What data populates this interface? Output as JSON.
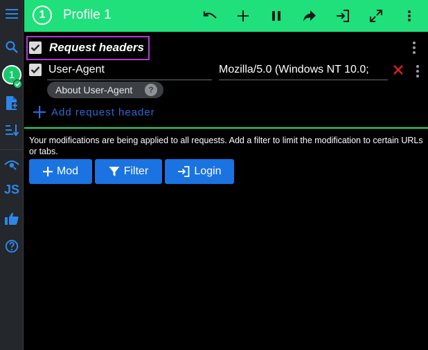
{
  "header": {
    "profile_number": "1",
    "title": "Profile 1",
    "accent_color": "#1fe07a",
    "actions": [
      "undo-icon",
      "plus-icon",
      "pause-icon",
      "share-icon",
      "login-icon",
      "expand-icon",
      "more-vert-icon"
    ]
  },
  "sidebar": {
    "items": [
      "menu-icon",
      "search-icon",
      "profile-1",
      "file-add-icon",
      "sort-icon",
      "eye-icon",
      "js-icon",
      "thumb-up-icon",
      "help-icon"
    ],
    "profile_badge": "1",
    "js_label": "JS"
  },
  "section": {
    "title": "Request headers",
    "enabled": true,
    "highlight_color": "#b43bd8"
  },
  "headers": [
    {
      "enabled": true,
      "name": "User-Agent",
      "value": "Mozilla/5.0 (Windows NT 10.0;",
      "about_label": "About User-Agent",
      "help_glyph": "?"
    }
  ],
  "add_header_label": "Add request header",
  "info_text": "Your modifications are being applied to all requests. Add a filter to limit the modification to certain URLs or tabs.",
  "buttons": {
    "mod": "Mod",
    "filter": "Filter",
    "login": "Login",
    "color": "#1a73e0"
  }
}
